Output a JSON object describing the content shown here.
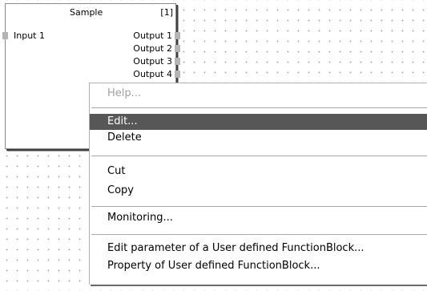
{
  "block": {
    "title": "Sample",
    "index": "[1]",
    "inputs": [
      "Input 1"
    ],
    "outputs": [
      "Output 1",
      "Output 2",
      "Output 3",
      "Output 4"
    ]
  },
  "context_menu": {
    "items": [
      {
        "label": "Help...",
        "state": "disabled"
      },
      {
        "label": "Edit...",
        "state": "highlighted"
      },
      {
        "label": "Delete",
        "state": "normal"
      },
      {
        "label": "Cut",
        "state": "normal"
      },
      {
        "label": "Copy",
        "state": "normal"
      },
      {
        "label": "Monitoring...",
        "state": "normal"
      },
      {
        "label": "Edit parameter of a User defined FunctionBlock...",
        "state": "normal"
      },
      {
        "label": "Property of User defined FunctionBlock...",
        "state": "normal"
      }
    ]
  }
}
